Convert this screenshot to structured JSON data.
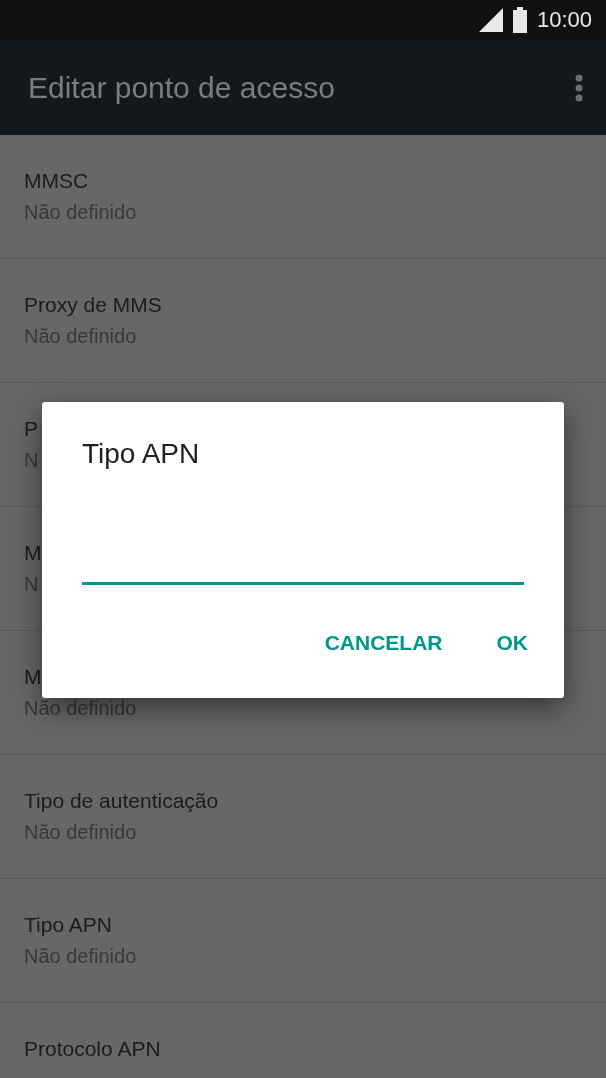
{
  "status_bar": {
    "time": "10:00"
  },
  "app_bar": {
    "title": "Editar ponto de acesso"
  },
  "settings": [
    {
      "title": "MMSC",
      "summary": "Não definido"
    },
    {
      "title": "Proxy de MMS",
      "summary": "Não definido"
    },
    {
      "title": "P",
      "summary": "N"
    },
    {
      "title": "M",
      "summary": "N"
    },
    {
      "title": "M",
      "summary": "Não definido"
    },
    {
      "title": "Tipo de autenticação",
      "summary": "Não definido"
    },
    {
      "title": "Tipo APN",
      "summary": "Não definido"
    },
    {
      "title": "Protocolo APN"
    }
  ],
  "dialog": {
    "title": "Tipo APN",
    "buttons": [
      "CANCELAR",
      "OK"
    ]
  }
}
